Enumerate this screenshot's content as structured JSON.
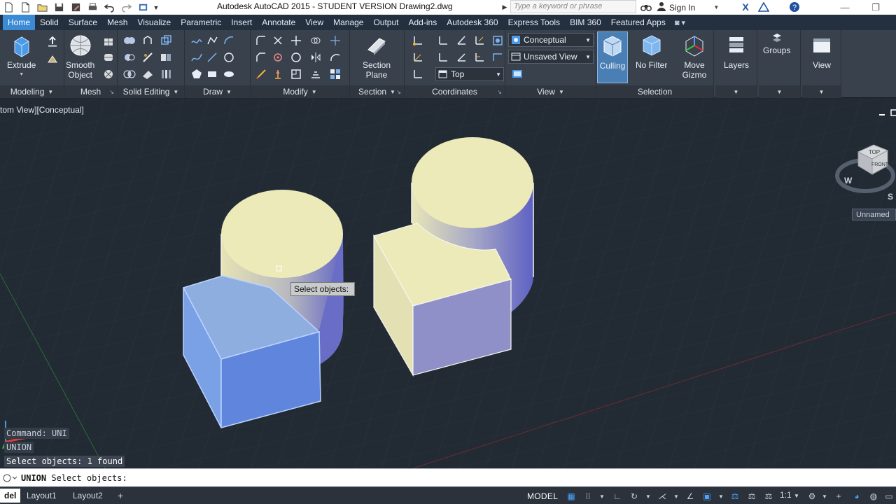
{
  "title_bar": {
    "title": "Autodesk AutoCAD 2015 - STUDENT VERSION    Drawing2.dwg",
    "search_placeholder": "Type a keyword or phrase",
    "sign_in": "Sign In"
  },
  "ribbon_tabs": [
    "Home",
    "Solid",
    "Surface",
    "Mesh",
    "Visualize",
    "Parametric",
    "Insert",
    "Annotate",
    "View",
    "Manage",
    "Output",
    "Add-ins",
    "Autodesk 360",
    "Express Tools",
    "BIM 360",
    "Featured Apps"
  ],
  "panels": {
    "modeling": "Modeling",
    "mesh": "Mesh",
    "solid_editing": "Solid Editing",
    "draw": "Draw",
    "modify": "Modify",
    "section": "Section",
    "coordinates": "Coordinates",
    "view": "View",
    "selection": "Selection"
  },
  "buttons": {
    "extrude": "Extrude",
    "smooth_object": "Smooth\nObject",
    "section_plane": "Section\nPlane",
    "culling": "Culling",
    "no_filter": "No Filter",
    "move_gizmo": "Move\nGizmo",
    "layers": "Layers",
    "groups": "Groups",
    "view": "View"
  },
  "dropdowns": {
    "visual_style": "Conceptual",
    "named_view": "Unsaved View",
    "ucs": "Top"
  },
  "viewport": {
    "label": "tom View][Conceptual]",
    "tooltip": "Select objects:",
    "viewcube": {
      "top": "TOP",
      "front": "FRONT",
      "west": "W",
      "south": "S"
    },
    "ucs_name": "Unnamed"
  },
  "command_history": [
    "Command: UNI",
    "UNION",
    "Select objects: 1 found"
  ],
  "command_line": {
    "command": "UNION",
    "prompt": "Select objects:"
  },
  "status_bar": {
    "layout_tabs": [
      "del",
      "Layout1",
      "Layout2"
    ],
    "add_tab": "+",
    "model": "MODEL",
    "scale": "1:1"
  },
  "colors": {
    "ribbon_bg": "#39414c",
    "tab_active": "#3b8ad6",
    "viewport_bg": "#222a33",
    "cylinder_top": "#eceab8",
    "cylinder_side_dark": "#6b6dc4",
    "box_selected": "#6b8fe0",
    "tooltip_bg": "#c9cacb"
  }
}
